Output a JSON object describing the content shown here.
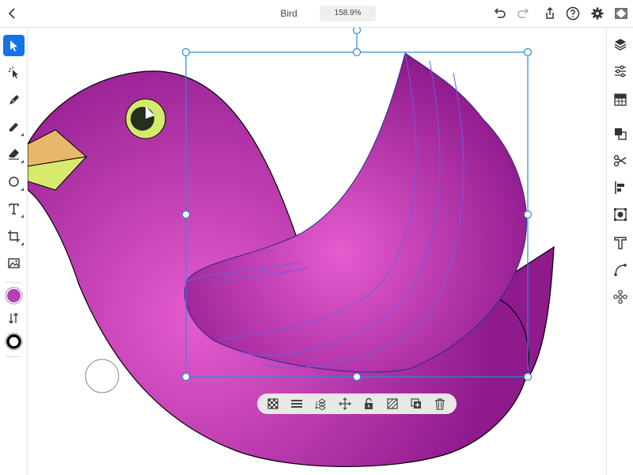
{
  "topbar": {
    "title": "Bird",
    "zoom": "158.9%",
    "icons": [
      "back-chevron-icon",
      "undo-icon",
      "redo-icon",
      "share-icon",
      "help-icon",
      "gear-icon",
      "fit-view-icon"
    ]
  },
  "left_toolbar": {
    "tools": [
      "selection",
      "direct-selection",
      "pen",
      "pencil",
      "eraser",
      "shape",
      "type",
      "transform",
      "image"
    ],
    "active_tool": "selection",
    "fill_color": "#b93cb4",
    "stroke_color": "#000000"
  },
  "right_toolbar": {
    "tools": [
      "layers",
      "properties",
      "libraries",
      "combine",
      "scissors",
      "align",
      "place",
      "type-options",
      "path",
      "repeat"
    ]
  },
  "canvas": {
    "selection_color": "#2d8ad6"
  },
  "context_bar": {
    "actions": [
      "opacity",
      "stroke-weight",
      "arrange",
      "transform",
      "lock",
      "mask",
      "duplicate",
      "delete"
    ]
  }
}
